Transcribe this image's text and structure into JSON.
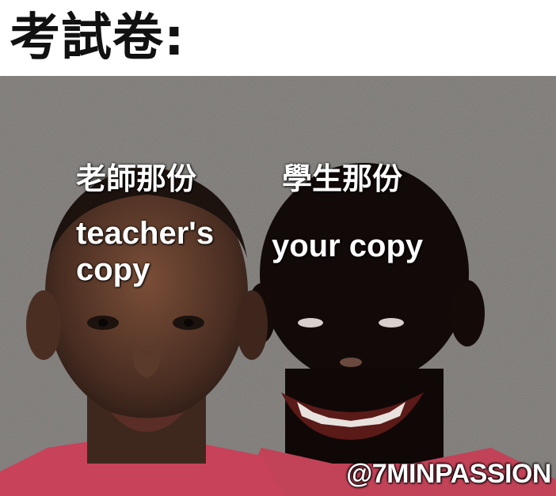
{
  "header": {
    "title": "考試卷:"
  },
  "meme": {
    "left": {
      "label_zh": "老師那份",
      "label_en": "teacher's copy"
    },
    "right": {
      "label_zh": "學生那份",
      "label_en": "your copy"
    }
  },
  "watermark": "@7MINPASSION",
  "colors": {
    "background_noise": "#8a8784",
    "shirt": "#c8425a",
    "skin": "#5a3a2a",
    "dark_face": "#1a0f0d",
    "text": "#ffffff"
  }
}
